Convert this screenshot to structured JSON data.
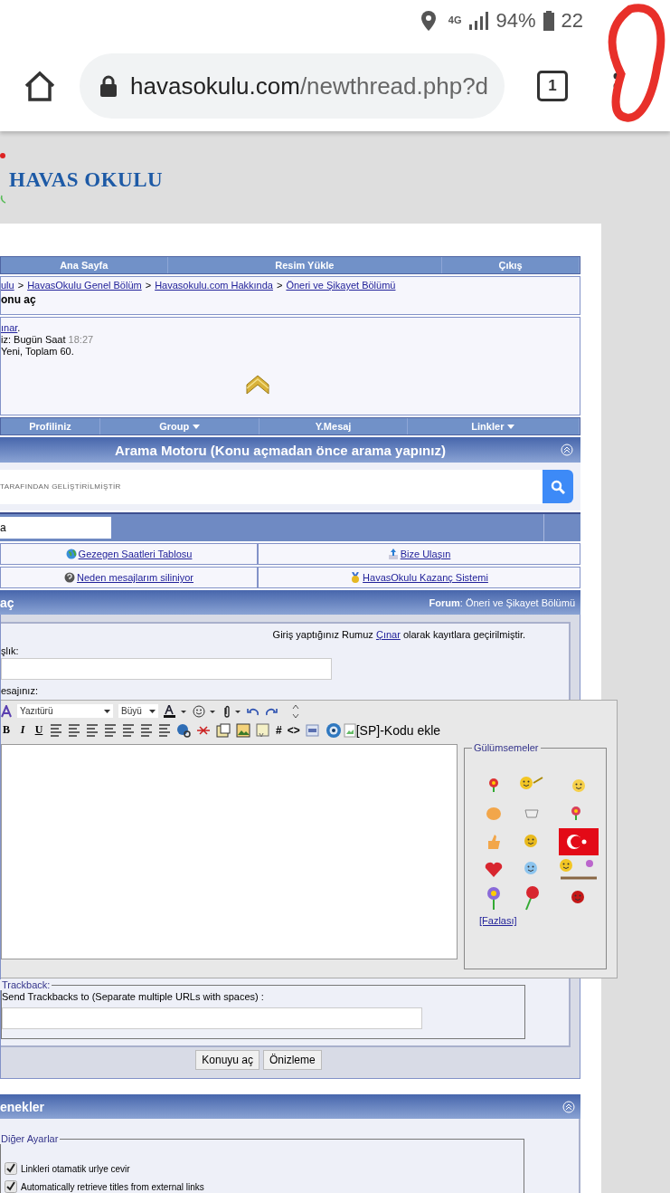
{
  "status_bar": {
    "network": "4G",
    "battery": "94%",
    "time": "22"
  },
  "browser": {
    "url_host": "havasokulu.com",
    "url_path": "/newthread.php?d",
    "tab_count": "1"
  },
  "logo": "HAVAS OKULU",
  "top_nav": [
    "Ana Sayfa",
    "Resim Yükle",
    "Çıkış"
  ],
  "breadcrumb": {
    "separator": ">",
    "items": [
      "ulu",
      "HavasOkulu Genel Bölüm",
      "Havasokulu.com Hakkında",
      "Öneri ve Şikayet Bölümü"
    ]
  },
  "page_title": "onu aç",
  "user_info": {
    "name": "ınar",
    "name_suffix": ".",
    "last_visit_label": "iz: Bugün Saat",
    "last_visit_time": "18:27",
    "messages": "Yeni, Toplam 60."
  },
  "user_nav": [
    {
      "label": "Profiliniz",
      "dropdown": false
    },
    {
      "label": "Group",
      "dropdown": true
    },
    {
      "label": "Y.Mesaj",
      "dropdown": false
    },
    {
      "label": "Linkler",
      "dropdown": true
    }
  ],
  "search": {
    "title": "Arama Motoru (Konu açmadan önce arama yapınız)",
    "placeholder": "TARAFINDAN GELİŞTİRİLMİŞTİR"
  },
  "quick_field": {
    "value": "a"
  },
  "links": [
    {
      "label": "Gezegen Saatleri Tablosu",
      "kind": "globe"
    },
    {
      "label": "Bize Ulaşın",
      "kind": "upload"
    },
    {
      "label": "Neden mesajlarım siliniyor",
      "kind": "question"
    },
    {
      "label": "HavasOkulu Kazanç Sistemi",
      "kind": "medal"
    }
  ],
  "form": {
    "title": "aç",
    "forum": "**Forum**: Öneri ve Şikayet Bölümü",
    "login_before": "Giriş yaptığınız Rumuz",
    "login_user": "Çınar",
    "login_after": "olarak kayıtlara geçirilmiştir.",
    "title_label": "şlık:",
    "message_label": "esajınız:"
  },
  "editor": {
    "font": "Yazıtürü",
    "size": "Büyü",
    "format_buttons": [
      "B",
      "I",
      "U"
    ],
    "code_buttons": [
      "#",
      "<>"
    ],
    "sp_code": "[SP]-Kodu ekle"
  },
  "smilies": {
    "title": "Gülümsemeler",
    "more": "[Fazlası]"
  },
  "trackback": {
    "legend": "Trackback:",
    "label": "Send Trackbacks to (Separate multiple URLs with spaces) :"
  },
  "buttons": [
    "Konuyu aç",
    "Önizleme"
  ],
  "options": {
    "title": "enekler",
    "legend": "Diğer Ayarlar",
    "items": [
      {
        "label": "Linkleri otamatik urlye cevir",
        "checked": true
      },
      {
        "label": "Automatically retrieve titles from external links",
        "checked": true
      }
    ]
  }
}
